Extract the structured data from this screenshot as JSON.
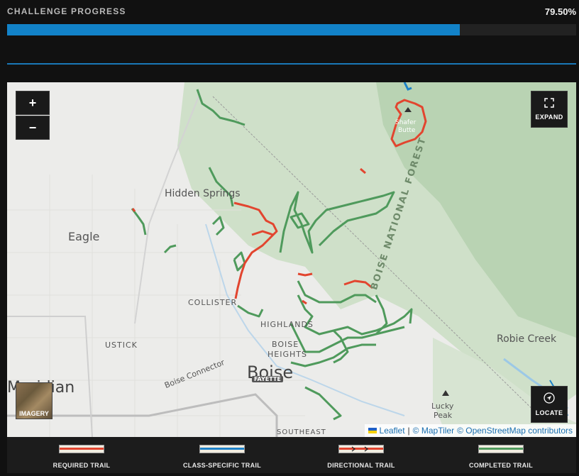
{
  "progress": {
    "label": "CHALLENGE PROGRESS",
    "value_text": "79.50%",
    "fraction": 0.795,
    "color": "#1282c8"
  },
  "map": {
    "labels": {
      "hidden_springs": "Hidden Springs",
      "eagle": "Eagle",
      "collister": "COLLISTER",
      "highlands": "HIGHLANDS",
      "boise_heights_1": "BOISE",
      "boise_heights_2": "HEIGHTS",
      "ustick": "USTICK",
      "boise": "Boise",
      "fayette": "FAYETTE",
      "meridian": "Meridian",
      "boise_connector": "Boise Connector",
      "lucky_peak_1": "Lucky",
      "lucky_peak_2": "Peak",
      "robie_creek": "Robie Creek",
      "southeast": "SOUTHEAST",
      "national_forest": "BOISE NATIONAL FOREST",
      "shafer_1": "Shafer",
      "shafer_2": "Butte"
    },
    "controls": {
      "zoom_in": "+",
      "zoom_out": "−",
      "expand": "EXPAND",
      "locate": "LOCATE",
      "imagery": "IMAGERY"
    },
    "icons": {
      "expand": "expand-icon",
      "locate": "locate-arrow-icon",
      "zoom_in": "plus-icon",
      "zoom_out": "minus-icon"
    },
    "attribution": {
      "leaflet": "Leaflet",
      "sep": "|",
      "maptiler": "© MapTiler",
      "osm": "© OpenStreetMap contributors"
    }
  },
  "legend": {
    "items": [
      {
        "label": "REQUIRED TRAIL",
        "color": "#e2452f"
      },
      {
        "label": "CLASS-SPECIFIC TRAIL",
        "color": "#1e82c8"
      },
      {
        "label": "DIRECTIONAL TRAIL",
        "color": "#e2452f"
      },
      {
        "label": "COMPLETED TRAIL",
        "color": "#4f9a5c"
      }
    ]
  },
  "colors": {
    "required": "#e2452f",
    "class_specific": "#1e82c8",
    "completed": "#4f9a5c",
    "forest": "#c9dcc4",
    "land": "#ececea"
  }
}
